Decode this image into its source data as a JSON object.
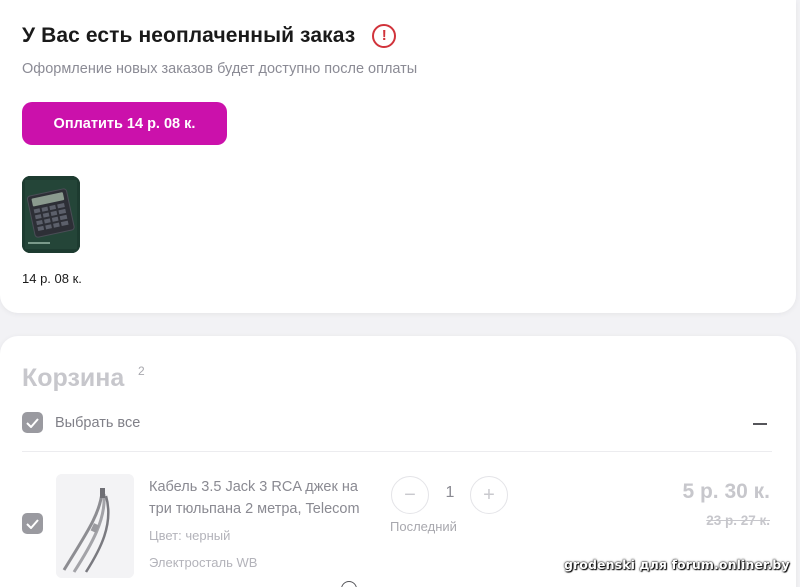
{
  "unpaid": {
    "title": "У Вас есть неоплаченный заказ",
    "subtitle": "Оформление новых заказов будет доступно после оплаты",
    "pay_button": "Оплатить 14 р. 08 к.",
    "warning_icon": "exclamation-circle-icon",
    "warning_color": "#d1333b",
    "item_price": "14 р. 08 к.",
    "item_image": "calculator-thumbnail"
  },
  "cart": {
    "title": "Корзина",
    "count": "2",
    "select_all": "Выбрать все",
    "collapse_icon": "minus-icon",
    "items": [
      {
        "name": "Кабель 3.5 Jack 3 RCA джек на три тюльпана 2 метра, Telecom",
        "color": "Цвет: черный",
        "seller": "Электросталь WB",
        "quantity": "1",
        "stock_note": "Последний",
        "decrement": "−",
        "increment": "+",
        "price": "5 р. 30 к.",
        "old_price": "23 р. 27 к.",
        "checked": true
      }
    ]
  },
  "colors": {
    "accent": "#cb11ab",
    "muted_text": "#8b8b95"
  },
  "watermark": "grodenski для forum.onliner.by"
}
